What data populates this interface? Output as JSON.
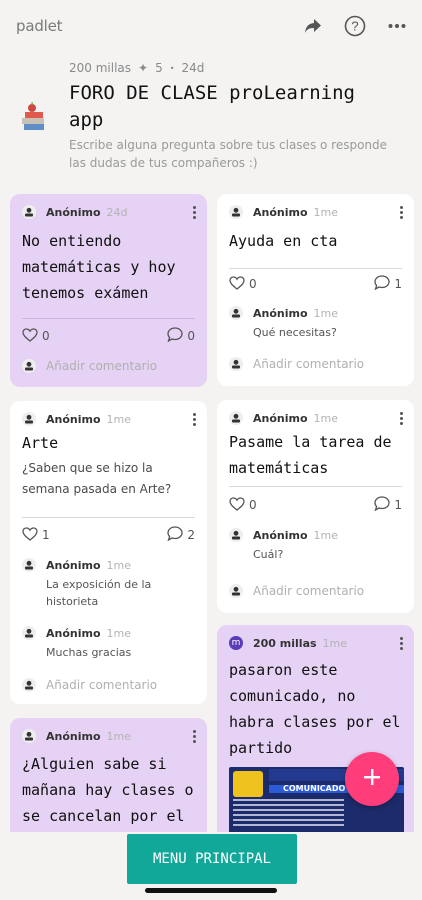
{
  "app": {
    "brand": "padlet"
  },
  "board": {
    "owner": "200 millas",
    "contributors": "5",
    "age": "24d",
    "title": "FORO DE CLASE proLearning app",
    "description": "Escribe alguna pregunta sobre tus clases o responde las dudas de tus compañeros :)"
  },
  "posts": {
    "p1": {
      "author": "Anónimo",
      "ago": "24d",
      "title": "No entiendo matemáticas y hoy tenemos exámen",
      "likes": "0",
      "comments": "0",
      "add_comment": "Añadir comentario"
    },
    "p2": {
      "author": "Anónimo",
      "ago": "1me",
      "title": "Ayuda en cta",
      "likes": "0",
      "comments": "1",
      "c1": {
        "author": "Anónimo",
        "ago": "1me",
        "text": "Qué necesitas?"
      },
      "add_comment": "Añadir comentario"
    },
    "p3": {
      "author": "Anónimo",
      "ago": "1me",
      "title": "Arte",
      "body": "¿Saben que se hizo la semana pasada en Arte?",
      "likes": "1",
      "comments": "2",
      "c1": {
        "author": "Anónimo",
        "ago": "1me",
        "text": "La exposición de la historieta"
      },
      "c2": {
        "author": "Anónimo",
        "ago": "1me",
        "text": "Muchas gracias"
      },
      "add_comment": "Añadir comentario"
    },
    "p4": {
      "author": "Anónimo",
      "ago": "1me",
      "title": "Pasame la tarea de matemáticas",
      "likes": "0",
      "comments": "1",
      "c1": {
        "author": "Anónimo",
        "ago": "1me",
        "text": "Cuál?"
      },
      "add_comment": "Añadir comentario"
    },
    "p5": {
      "author": "Anónimo",
      "ago": "1me",
      "title": "¿Alguien sabe si mañana hay clases o se cancelan por el"
    },
    "p6": {
      "author": "200 millas",
      "author_initial": "m",
      "ago": "1me",
      "title": "pasaron este comunicado, no habra clases por el partido",
      "image_caption": "COMUNICADO"
    }
  },
  "bottom": {
    "menu_label": "MENU PRINCIPAL"
  },
  "colors": {
    "purple_card": "#e6d2f5",
    "fab": "#ff3d7a",
    "menu_button": "#11a89a"
  }
}
